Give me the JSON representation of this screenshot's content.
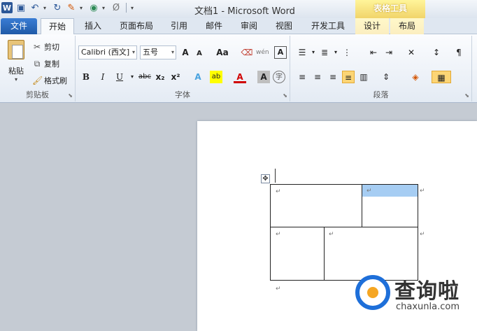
{
  "window": {
    "title": "文档1 - Microsoft Word"
  },
  "qat": {
    "word_logo": "W",
    "save_icon": "save-icon",
    "undo_icon": "undo-icon",
    "redo_icon": "redo-icon"
  },
  "context": {
    "header": "表格工具"
  },
  "tabs": [
    "文件",
    "开始",
    "插入",
    "页面布局",
    "引用",
    "邮件",
    "审阅",
    "视图",
    "开发工具",
    "设计",
    "布局"
  ],
  "clipboard": {
    "paste": "粘贴",
    "cut": "剪切",
    "copy": "复制",
    "format_painter": "格式刷",
    "group": "剪贴板"
  },
  "font": {
    "name": "Calibri (西文]",
    "size": "五号",
    "grow": "A",
    "shrink": "A",
    "case": "Aa",
    "clear": "⌫",
    "phonetic": "wén",
    "enclose": "A",
    "bold": "B",
    "italic": "I",
    "underline": "U",
    "strike": "abc",
    "sub": "x₂",
    "sup": "x²",
    "effects": "A",
    "highlight": "ab",
    "color": "A",
    "shade": "A",
    "circle": "字",
    "group": "字体"
  },
  "paragraph": {
    "group": "段落"
  },
  "document": {
    "para_mark": "↵"
  },
  "watermark": {
    "text": "查询啦",
    "url": "chaxunla.com"
  }
}
